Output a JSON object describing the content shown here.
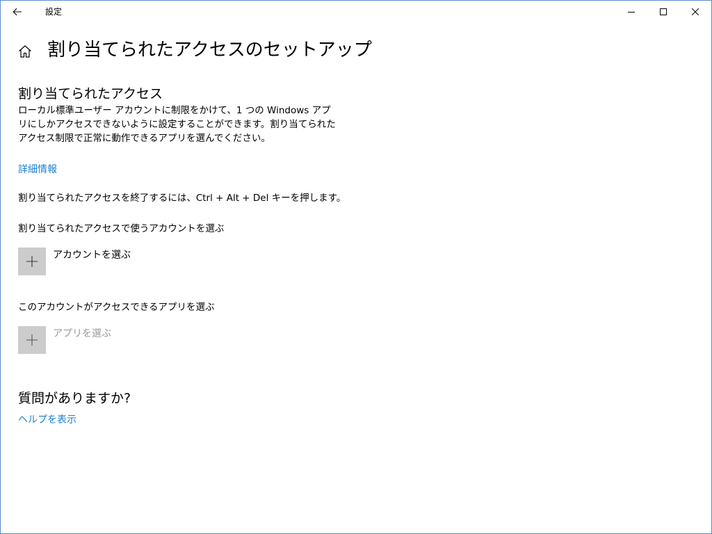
{
  "window": {
    "title": "設定"
  },
  "icons": {
    "back": "back-arrow-icon",
    "home": "home-icon",
    "minimize": "minimize-icon",
    "maximize": "maximize-icon",
    "close": "close-icon",
    "add": "plus-icon"
  },
  "header": {
    "title": "割り当てられたアクセスのセットアップ"
  },
  "assigned_access": {
    "heading": "割り当てられたアクセス",
    "description": "ローカル標準ユーザー アカウントに制限をかけて、1 つの Windows アプリにしかアクセスできないように設定することができます。割り当てられたアクセス制限で正常に動作できるアプリを選んでください。",
    "learn_more": "詳細情報",
    "exit_info": "割り当てられたアクセスを終了するには、Ctrl + Alt + Del キーを押します。",
    "account_label": "割り当てられたアクセスで使うアカウントを選ぶ",
    "account_button": "アカウントを選ぶ",
    "app_label": "このアカウントがアクセスできるアプリを選ぶ",
    "app_button": "アプリを選ぶ"
  },
  "help": {
    "heading": "質問がありますか?",
    "link": "ヘルプを表示"
  },
  "colors": {
    "accent": "#1a7fd1",
    "border": "#5b8bd4",
    "tile": "#cccccc",
    "disabled_text": "#9a9a9a"
  }
}
